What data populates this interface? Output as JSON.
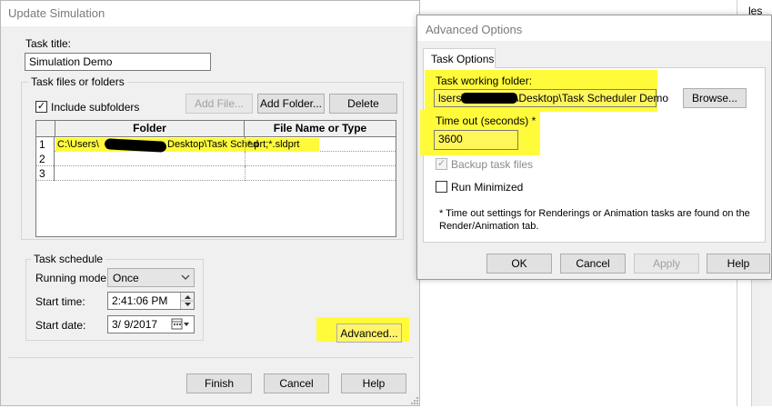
{
  "update_dialog": {
    "title": "Update Simulation",
    "task_title_label": "Task title:",
    "task_title_value": "Simulation Demo",
    "task_files_group": "Task files or folders",
    "include_subfolders_label": "Include subfolders",
    "include_subfolders_checked": true,
    "add_file_label": "Add File...",
    "add_folder_label": "Add Folder...",
    "delete_label": "Delete",
    "table": {
      "columns": [
        "Folder",
        "File Name or Type"
      ],
      "rows": [
        {
          "num": "1",
          "folder": "C:\\Users\\",
          "folder_tail": "Desktop\\Task Sched",
          "file": "*.prt;*.sldprt"
        },
        {
          "num": "2",
          "folder": "",
          "folder_tail": "",
          "file": ""
        },
        {
          "num": "3",
          "folder": "",
          "folder_tail": "",
          "file": ""
        }
      ]
    },
    "schedule_group": "Task schedule",
    "running_mode_label": "Running mode:",
    "running_mode_value": "Once",
    "start_time_label": "Start time:",
    "start_time_value": "2:41:06 PM",
    "start_date_label": "Start date:",
    "start_date_value": "3/  9/2017",
    "advanced_label": "Advanced...",
    "finish_label": "Finish",
    "cancel_label": "Cancel",
    "help_label": "Help"
  },
  "advanced_dialog": {
    "title": "Advanced Options",
    "tab_label": "Task Options",
    "working_folder_label": "Task working folder:",
    "working_folder_value_start": "lsers\\",
    "working_folder_value_end": "\\Desktop\\Task Scheduler Demo",
    "browse_label": "Browse...",
    "timeout_label": "Time out (seconds) *",
    "timeout_value": "3600",
    "backup_label": "Backup task files",
    "backup_checked": true,
    "run_minimized_label": "Run Minimized",
    "run_minimized_checked": false,
    "note_line1": "* Time out settings for Renderings or Animation tasks are found on the",
    "note_line2": "Render/Animation tab.",
    "ok_label": "OK",
    "cancel_label": "Cancel",
    "apply_label": "Apply",
    "help_label": "Help"
  },
  "background_window": {
    "fragment": "les"
  },
  "colors": {
    "highlight": "#fffb3a",
    "dialog_bg": "#f0f0f0",
    "redaction": "#000000"
  }
}
